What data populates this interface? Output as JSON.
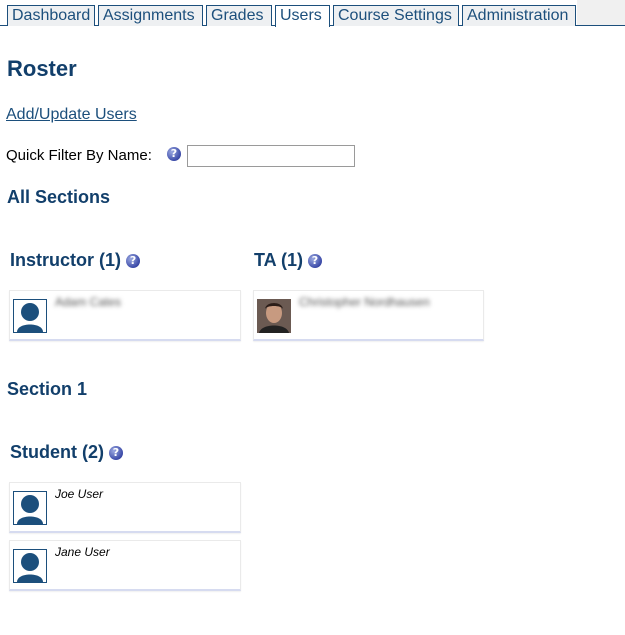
{
  "tabs": [
    {
      "label": "Dashboard"
    },
    {
      "label": "Assignments"
    },
    {
      "label": "Grades"
    },
    {
      "label": "Users"
    },
    {
      "label": "Course Settings"
    },
    {
      "label": "Administration"
    }
  ],
  "active_tab": "Users",
  "page_title": "Roster",
  "add_update_link": "Add/Update Users",
  "quick_filter": {
    "label": "Quick Filter By Name:",
    "value": "",
    "placeholder": ""
  },
  "help_glyph": "?",
  "all_sections": {
    "title": "All Sections",
    "instructor": {
      "title": "Instructor (1)",
      "users": [
        {
          "name": "Adam Cates"
        }
      ]
    },
    "ta": {
      "title": "TA (1)",
      "users": [
        {
          "name": "Christopher Nordhausen"
        }
      ]
    }
  },
  "section1": {
    "title": "Section 1",
    "student": {
      "title": "Student (2)",
      "users": [
        {
          "name": "Joe User"
        },
        {
          "name": "Jane User"
        }
      ]
    }
  },
  "colors": {
    "accent": "#1c4f7c",
    "heading": "#123f6b",
    "help_icon": "#3b4aa8"
  }
}
